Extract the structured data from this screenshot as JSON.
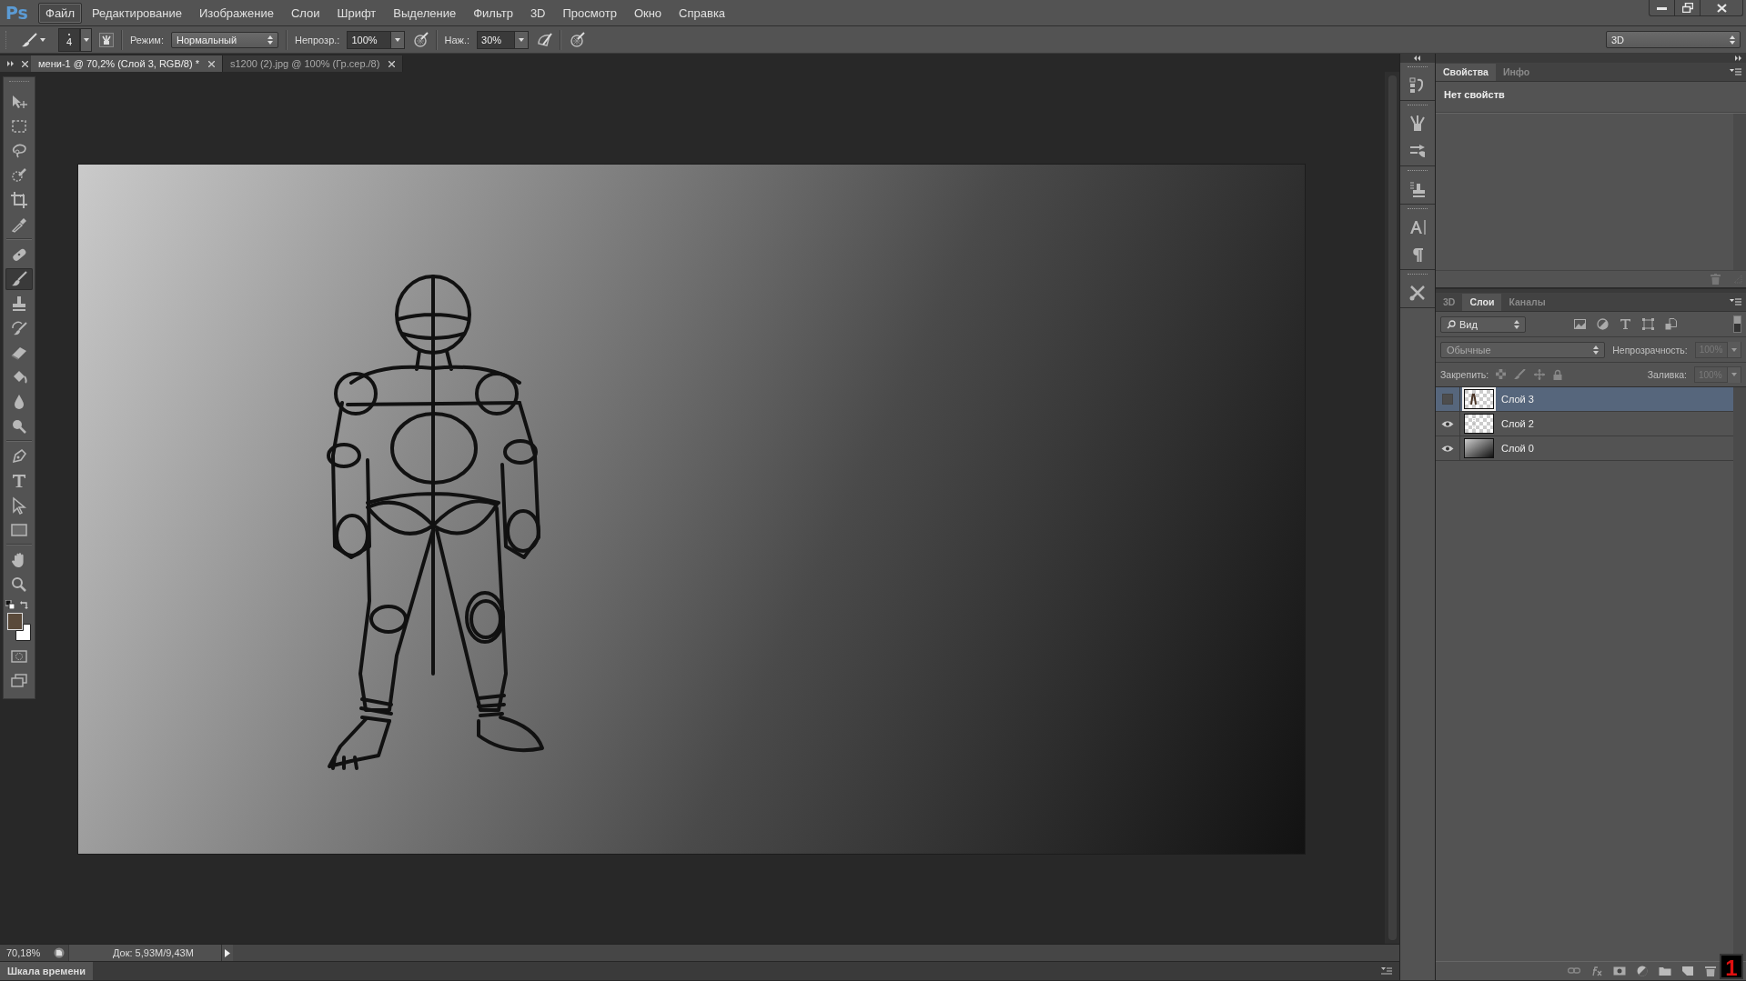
{
  "app_logo": "Ps",
  "menu": [
    {
      "label": "Файл",
      "selected": true
    },
    {
      "label": "Редактирование",
      "selected": false
    },
    {
      "label": "Изображение",
      "selected": false
    },
    {
      "label": "Слои",
      "selected": false
    },
    {
      "label": "Шрифт",
      "selected": false
    },
    {
      "label": "Выделение",
      "selected": false
    },
    {
      "label": "Фильтр",
      "selected": false
    },
    {
      "label": "3D",
      "selected": false
    },
    {
      "label": "Просмотр",
      "selected": false
    },
    {
      "label": "Окно",
      "selected": false
    },
    {
      "label": "Справка",
      "selected": false
    }
  ],
  "options_bar": {
    "brush_size": "4",
    "mode_label": "Режим:",
    "mode": "Нормальный",
    "opacity_label": "Непрозр.:",
    "opacity": "100%",
    "flow_label": "Наж.:",
    "flow": "30%",
    "workspace": "3D"
  },
  "document_tabs": [
    {
      "title": "мени-1 @ 70,2% (Слой 3, RGB/8) *",
      "selected": true
    },
    {
      "title": "s1200 (2).jpg @ 100% (Гр.сер./8)",
      "selected": false
    }
  ],
  "tools": [
    {
      "selected": false
    },
    {
      "selected": false
    },
    {
      "selected": false
    },
    {
      "selected": false
    },
    {
      "selected": false
    },
    {
      "selected": false
    },
    {
      "selected": false
    },
    {
      "selected": true
    },
    {
      "selected": false
    },
    {
      "selected": false
    },
    {
      "selected": false
    },
    {
      "selected": false
    },
    {
      "selected": false
    },
    {
      "selected": false
    },
    {
      "selected": false
    },
    {
      "selected": false
    },
    {
      "selected": false
    },
    {
      "selected": false
    },
    {
      "selected": false
    },
    {
      "selected": false
    }
  ],
  "properties_panel": {
    "tabs": [
      {
        "label": "Свойства",
        "selected": true
      },
      {
        "label": "Инфо",
        "selected": false
      }
    ],
    "message": "Нет свойств"
  },
  "layers_panel": {
    "tabs": [
      {
        "label": "3D",
        "selected": false
      },
      {
        "label": "Слои",
        "selected": true
      },
      {
        "label": "Каналы",
        "selected": false
      }
    ],
    "filter": "Вид",
    "filter_on": true,
    "blend_mode": "Обычные",
    "opacity_label": "Непрозрачность:",
    "opacity": "100%",
    "lock_label": "Закрепить:",
    "fill_label": "Заливка:",
    "fill": "100%",
    "layers": [
      {
        "name": "Слой 3",
        "visible": false,
        "selected": true
      },
      {
        "name": "Слой 2",
        "visible": true,
        "selected": false
      },
      {
        "name": "Слой 0",
        "visible": true,
        "selected": false
      }
    ]
  },
  "status_bar": {
    "zoom": "70,18%",
    "doc_info": "Док: 5,93M/9,43M"
  },
  "timeline_tab": "Шкала времени",
  "overlay_badge": "1"
}
